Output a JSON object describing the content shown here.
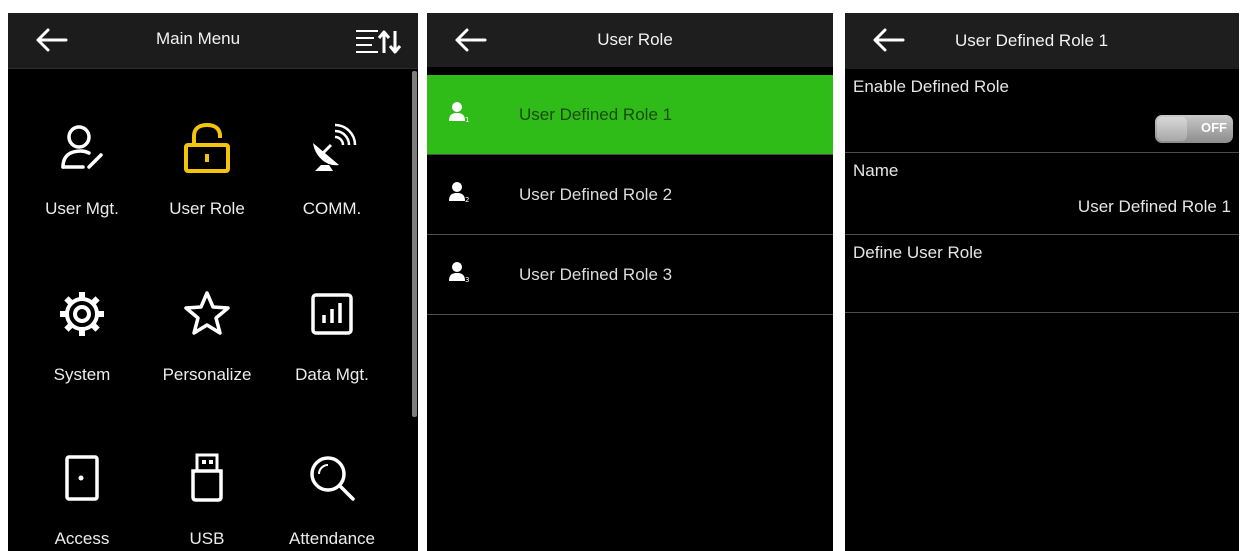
{
  "main_menu": {
    "title": "Main Menu",
    "items": [
      {
        "label": "User Mgt.",
        "icon": "user-edit-icon"
      },
      {
        "label": "User Role",
        "icon": "padlock-icon"
      },
      {
        "label": "COMM.",
        "icon": "satellite-dish-icon"
      },
      {
        "label": "System",
        "icon": "gear-icon"
      },
      {
        "label": "Personalize",
        "icon": "star-icon"
      },
      {
        "label": "Data Mgt.",
        "icon": "bar-chart-icon"
      },
      {
        "label": "Access",
        "icon": "door-icon"
      },
      {
        "label": "USB",
        "icon": "usb-drive-icon"
      },
      {
        "label": "Attendance",
        "icon": "search-icon"
      }
    ]
  },
  "user_role": {
    "title": "User Role",
    "selected_index": 0,
    "items": [
      {
        "label": "User Defined Role 1"
      },
      {
        "label": "User Defined Role 2"
      },
      {
        "label": "User Defined Role 3"
      }
    ]
  },
  "role_detail": {
    "title": "User Defined Role 1",
    "enable_label": "Enable Defined Role",
    "toggle_text": "OFF",
    "name_label": "Name",
    "name_value": "User Defined Role 1",
    "define_label": "Define User Role"
  },
  "colors": {
    "accent": "#2fbb18",
    "icon_highlight": "#f4c40a",
    "background": "#000000",
    "header": "#1e1e1e"
  }
}
